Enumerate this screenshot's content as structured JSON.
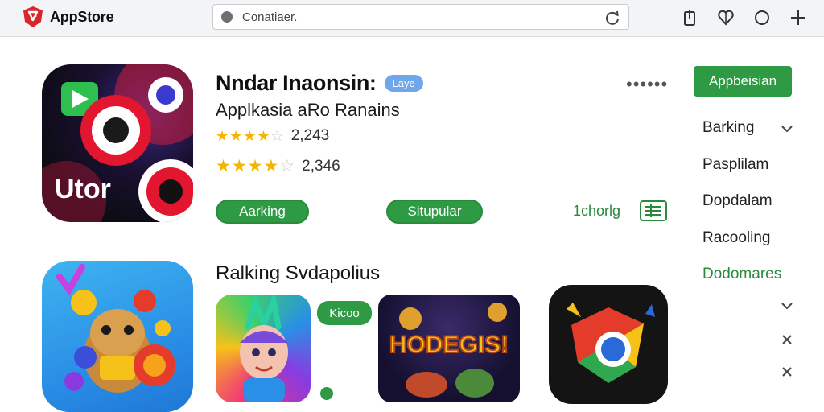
{
  "brand": {
    "name": "AppStore"
  },
  "search": {
    "value": "Conatiaer."
  },
  "app": {
    "title": "Nndar Inaonsin:",
    "badge": "Laye",
    "subtitle": "Applkasia aRo Ranains",
    "ratings": [
      {
        "stars": 4.5,
        "count": "2,243"
      },
      {
        "stars": 4.0,
        "count": "2,346"
      }
    ],
    "buttons": [
      "Aarking",
      "Situpular"
    ],
    "link": "1chorlg",
    "icon_text": "Utor"
  },
  "sidebar": {
    "button": "Appbeisian",
    "items": [
      "Barking",
      "Pasplilam",
      "Dopdalam",
      "Racooling",
      "Dodomares"
    ]
  },
  "section": {
    "title": "Ralking Svdapolius",
    "tag": "Kicoo",
    "game_text": "HODEGIS!"
  },
  "colors": {
    "accent_green": "#2e9a43",
    "badge_blue": "#6fa7ea",
    "star": "#f2b600"
  }
}
